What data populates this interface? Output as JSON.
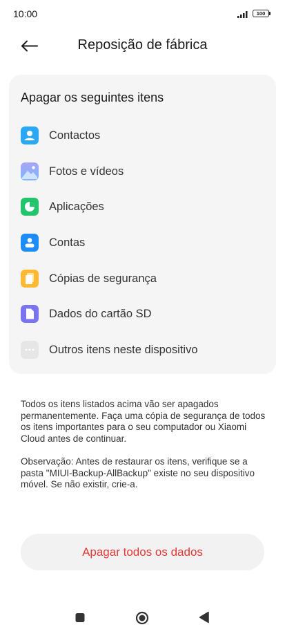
{
  "status_bar": {
    "time": "10:00",
    "battery": "100"
  },
  "header": {
    "title": "Reposição de fábrica"
  },
  "card": {
    "title": "Apagar os seguintes itens",
    "items": [
      {
        "label": "Contactos",
        "icon": "contacts-icon",
        "color": "#2aa7f5"
      },
      {
        "label": "Fotos e vídeos",
        "icon": "gallery-icon",
        "color": "#8c9bf5"
      },
      {
        "label": "Aplicações",
        "icon": "apps-icon",
        "color": "#22c56b"
      },
      {
        "label": "Contas",
        "icon": "account-icon",
        "color": "#1e8cf5"
      },
      {
        "label": "Cópias de segurança",
        "icon": "backup-icon",
        "color": "#fdb932"
      },
      {
        "label": "Dados do cartão SD",
        "icon": "sd-card-icon",
        "color": "#7b74f0"
      },
      {
        "label": "Outros itens neste dispositivo",
        "icon": "more-icon",
        "color": "#e6e6e6"
      }
    ]
  },
  "description": {
    "warning": "Todos os itens listados acima vão ser apagados permanentemente. Faça uma cópia de segurança de todos os itens importantes para o seu computador ou Xiaomi Cloud antes de continuar.",
    "note": "Observação: Antes de restaurar os itens, verifique se a pasta \"MIUI-Backup-AllBackup\" existe no seu dispositivo móvel. Se não existir, crie-a."
  },
  "erase_button": {
    "label": "Apagar todos os dados",
    "color": "#e53935"
  },
  "nav_bar": {
    "recents_icon": "square-icon",
    "home_icon": "circle-icon",
    "back_icon": "triangle-icon"
  }
}
